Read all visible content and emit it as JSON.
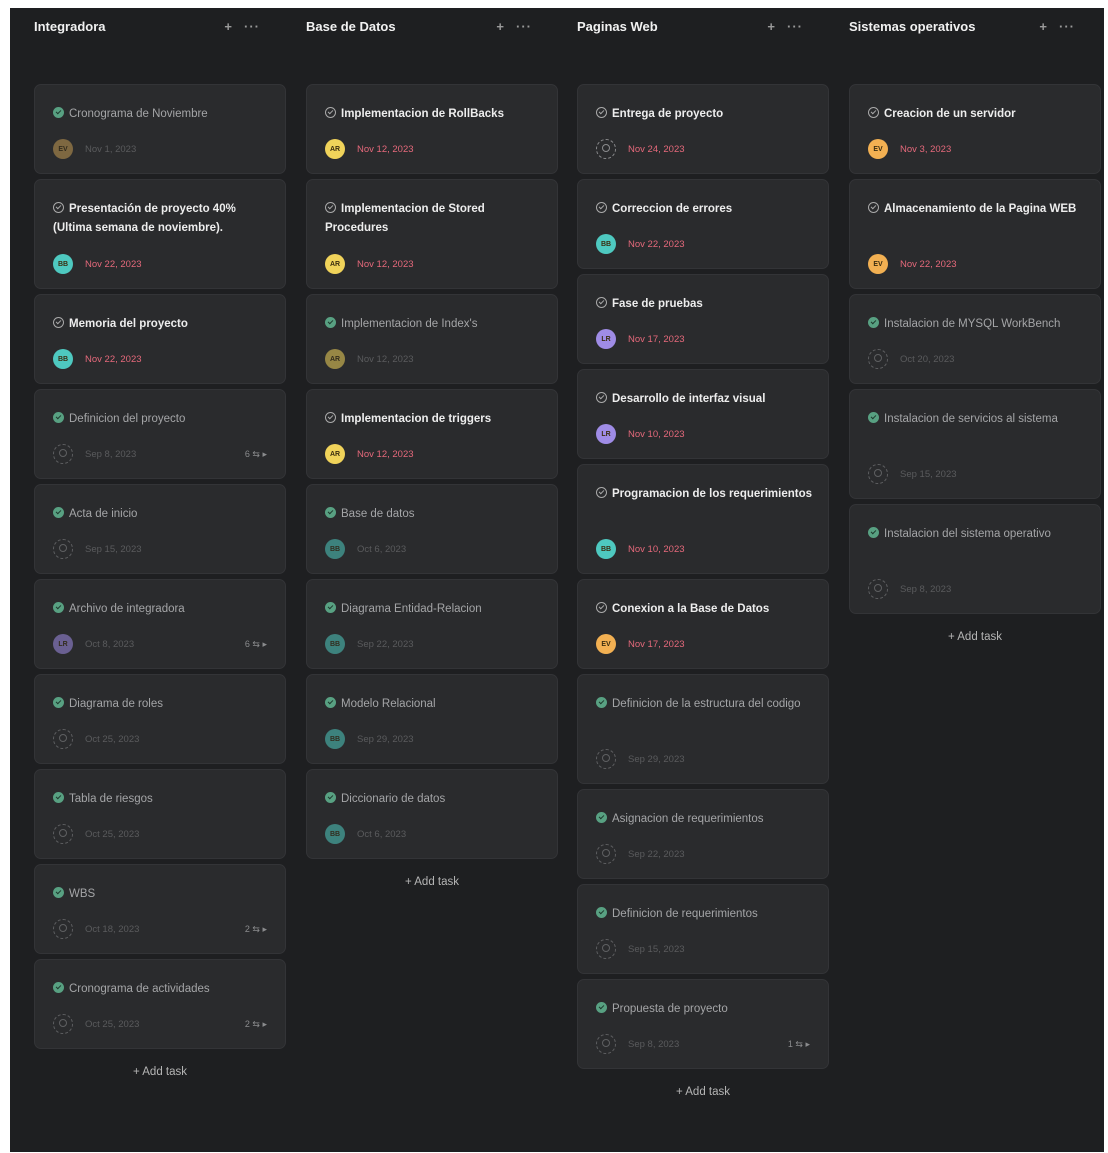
{
  "board": {
    "columns": [
      {
        "title": "Integradora",
        "add_icon": "+",
        "more_icon": "···",
        "add_task_label": "+ Add task",
        "cards": [
          {
            "title": "Cronograma de Noviembre",
            "done": true,
            "avatar": "EV",
            "avatar_color": "#c49a52",
            "due": "Nov 1, 2023",
            "subtasks": ""
          },
          {
            "title": "Presentación de proyecto 40% (Ultima semana de noviembre).",
            "done": false,
            "avatar": "BB",
            "avatar_color": "#4ec9c0",
            "due": "Nov 22, 2023",
            "subtasks": ""
          },
          {
            "title": "Memoria del proyecto",
            "done": false,
            "avatar": "BB",
            "avatar_color": "#4ec9c0",
            "due": "Nov 22, 2023",
            "subtasks": ""
          },
          {
            "title": "Definicion del proyecto",
            "done": true,
            "avatar": "",
            "avatar_color": "",
            "due": "Sep 8, 2023",
            "subtasks": "6 ⇆ ▸"
          },
          {
            "title": "Acta de inicio",
            "done": true,
            "avatar": "",
            "avatar_color": "",
            "due": "Sep 15, 2023",
            "subtasks": ""
          },
          {
            "title": "Archivo de integradora",
            "done": true,
            "avatar": "LR",
            "avatar_color": "#9f8ce6",
            "due": "Oct 8, 2023",
            "subtasks": "6 ⇆ ▸"
          },
          {
            "title": "Diagrama de roles",
            "done": true,
            "avatar": "",
            "avatar_color": "",
            "due": "Oct 25, 2023",
            "subtasks": ""
          },
          {
            "title": "Tabla de riesgos",
            "done": true,
            "avatar": "",
            "avatar_color": "",
            "due": "Oct 25, 2023",
            "subtasks": ""
          },
          {
            "title": "WBS",
            "done": true,
            "avatar": "",
            "avatar_color": "",
            "due": "Oct 18, 2023",
            "subtasks": "2 ⇆ ▸"
          },
          {
            "title": "Cronograma de actividades",
            "done": true,
            "avatar": "",
            "avatar_color": "",
            "due": "Oct 25, 2023",
            "subtasks": "2 ⇆ ▸"
          }
        ]
      },
      {
        "title": "Base de Datos",
        "add_icon": "+",
        "more_icon": "···",
        "add_task_label": "+ Add task",
        "cards": [
          {
            "title": "Implementacion de RollBacks",
            "done": false,
            "avatar": "AR",
            "avatar_color": "#f0d35a",
            "due": "Nov 12, 2023",
            "subtasks": ""
          },
          {
            "title": "Implementacion de Stored Procedures",
            "done": false,
            "avatar": "AR",
            "avatar_color": "#f0d35a",
            "due": "Nov 12, 2023",
            "subtasks": ""
          },
          {
            "title": "Implementacion de Index's",
            "done": true,
            "avatar": "AR",
            "avatar_color": "#f0d35a",
            "due": "Nov 12, 2023",
            "subtasks": ""
          },
          {
            "title": "Implementacion de triggers",
            "done": false,
            "avatar": "AR",
            "avatar_color": "#f0d35a",
            "due": "Nov 12, 2023",
            "subtasks": ""
          },
          {
            "title": "Base de datos",
            "done": true,
            "avatar": "BB",
            "avatar_color": "#4ec9c0",
            "due": "Oct 6, 2023",
            "subtasks": ""
          },
          {
            "title": "Diagrama Entidad-Relacion",
            "done": true,
            "avatar": "BB",
            "avatar_color": "#4ec9c0",
            "due": "Sep 22, 2023",
            "subtasks": ""
          },
          {
            "title": "Modelo Relacional",
            "done": true,
            "avatar": "BB",
            "avatar_color": "#4ec9c0",
            "due": "Sep 29, 2023",
            "subtasks": ""
          },
          {
            "title": "Diccionario de datos",
            "done": true,
            "avatar": "BB",
            "avatar_color": "#4ec9c0",
            "due": "Oct 6, 2023",
            "subtasks": ""
          }
        ]
      },
      {
        "title": "Paginas Web",
        "add_icon": "+",
        "more_icon": "···",
        "add_task_label": "+ Add task",
        "cards": [
          {
            "title": "Entrega de proyecto",
            "done": false,
            "avatar": "",
            "avatar_color": "",
            "due": "Nov 24, 2023",
            "subtasks": ""
          },
          {
            "title": "Correccion de errores",
            "done": false,
            "avatar": "BB",
            "avatar_color": "#4ec9c0",
            "due": "Nov 22, 2023",
            "subtasks": ""
          },
          {
            "title": "Fase de pruebas",
            "done": false,
            "avatar": "LR",
            "avatar_color": "#9f8ce6",
            "due": "Nov 17, 2023",
            "subtasks": ""
          },
          {
            "title": "Desarrollo de interfaz visual",
            "done": false,
            "avatar": "LR",
            "avatar_color": "#9f8ce6",
            "due": "Nov 10, 2023",
            "subtasks": ""
          },
          {
            "title": "Programacion de los requerimientos",
            "done": false,
            "avatar": "BB",
            "avatar_color": "#4ec9c0",
            "due": "Nov 10, 2023",
            "subtasks": ""
          },
          {
            "title": "Conexion a la Base de Datos",
            "done": false,
            "avatar": "EV",
            "avatar_color": "#f2b052",
            "due": "Nov 17, 2023",
            "subtasks": ""
          },
          {
            "title": "Definicion de la estructura del codigo",
            "done": true,
            "avatar": "",
            "avatar_color": "",
            "due": "Sep 29, 2023",
            "subtasks": ""
          },
          {
            "title": "Asignacion de requerimientos",
            "done": true,
            "avatar": "",
            "avatar_color": "",
            "due": "Sep 22, 2023",
            "subtasks": ""
          },
          {
            "title": "Definicion de requerimientos",
            "done": true,
            "avatar": "",
            "avatar_color": "",
            "due": "Sep 15, 2023",
            "subtasks": ""
          },
          {
            "title": "Propuesta de proyecto",
            "done": true,
            "avatar": "",
            "avatar_color": "",
            "due": "Sep 8, 2023",
            "subtasks": "1 ⇆ ▸"
          }
        ]
      },
      {
        "title": "Sistemas operativos",
        "add_icon": "+",
        "more_icon": "···",
        "add_task_label": "+ Add task",
        "cards": [
          {
            "title": "Creacion de un servidor",
            "done": false,
            "avatar": "EV",
            "avatar_color": "#f2b052",
            "due": "Nov 3, 2023",
            "subtasks": ""
          },
          {
            "title": "Almacenamiento de la Pagina WEB",
            "done": false,
            "avatar": "EV",
            "avatar_color": "#f2b052",
            "due": "Nov 22, 2023",
            "subtasks": ""
          },
          {
            "title": "Instalacion de MYSQL WorkBench",
            "done": true,
            "avatar": "",
            "avatar_color": "",
            "due": "Oct 20, 2023",
            "subtasks": ""
          },
          {
            "title": "Instalacion de servicios al sistema",
            "done": true,
            "avatar": "",
            "avatar_color": "",
            "due": "Sep 15, 2023",
            "subtasks": ""
          },
          {
            "title": "Instalacion del sistema operativo",
            "done": true,
            "avatar": "",
            "avatar_color": "",
            "due": "Sep 8, 2023",
            "subtasks": ""
          }
        ]
      }
    ]
  }
}
